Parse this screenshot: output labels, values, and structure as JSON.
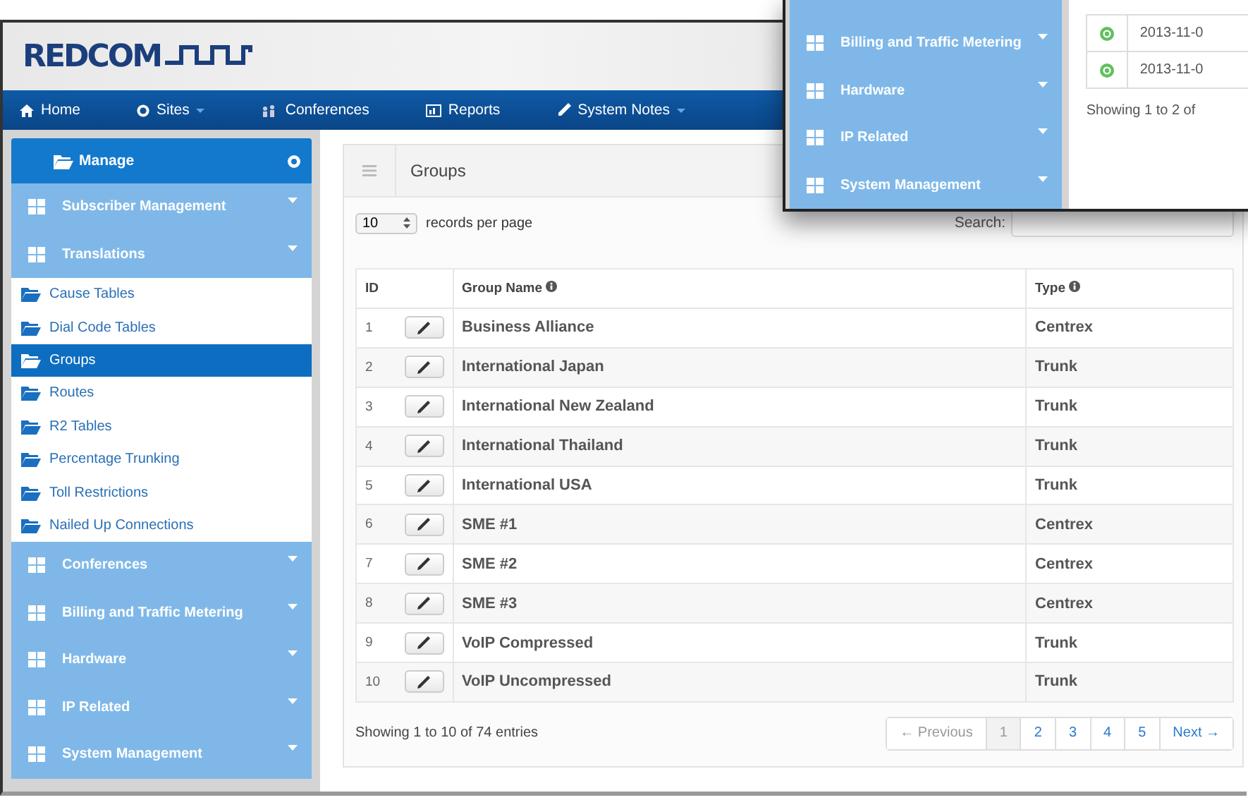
{
  "header": {
    "logo": "REDCOM"
  },
  "nav": [
    {
      "label": "Home",
      "kind": "home",
      "dropdown": false
    },
    {
      "label": "Sites",
      "kind": "sites",
      "dropdown": true
    },
    {
      "label": "Conferences",
      "kind": "conferences",
      "dropdown": false
    },
    {
      "label": "Reports",
      "kind": "reports",
      "dropdown": false
    },
    {
      "label": "System Notes",
      "kind": "notes",
      "dropdown": true
    }
  ],
  "sidebar": {
    "title": "Manage",
    "sections": [
      {
        "label": "Subscriber Management"
      },
      {
        "label": "Translations",
        "children": [
          {
            "label": "Cause Tables",
            "selected": false
          },
          {
            "label": "Dial Code Tables",
            "selected": false
          },
          {
            "label": "Groups",
            "selected": true
          },
          {
            "label": "Routes",
            "selected": false
          },
          {
            "label": "R2 Tables",
            "selected": false
          },
          {
            "label": "Percentage Trunking",
            "selected": false
          },
          {
            "label": "Toll Restrictions",
            "selected": false
          },
          {
            "label": "Nailed Up Connections",
            "selected": false
          }
        ]
      },
      {
        "label": "Conferences"
      },
      {
        "label": "Billing and Traffic Metering"
      },
      {
        "label": "Hardware"
      },
      {
        "label": "IP Related"
      },
      {
        "label": "System Management"
      }
    ]
  },
  "panel": {
    "title": "Groups",
    "page_size": "10",
    "page_size_label": "records per page",
    "search_label": "Search:",
    "columns": [
      "ID",
      "Group Name",
      "Type"
    ],
    "rows": [
      {
        "id": "1",
        "name": "Business Alliance",
        "type": "Centrex"
      },
      {
        "id": "2",
        "name": "International Japan",
        "type": "Trunk"
      },
      {
        "id": "3",
        "name": "International New Zealand",
        "type": "Trunk"
      },
      {
        "id": "4",
        "name": "International Thailand",
        "type": "Trunk"
      },
      {
        "id": "5",
        "name": "International USA",
        "type": "Trunk"
      },
      {
        "id": "6",
        "name": "SME #1",
        "type": "Centrex"
      },
      {
        "id": "7",
        "name": "SME #2",
        "type": "Centrex"
      },
      {
        "id": "8",
        "name": "SME #3",
        "type": "Centrex"
      },
      {
        "id": "9",
        "name": "VoIP Compressed",
        "type": "Trunk"
      },
      {
        "id": "10",
        "name": "VoIP Uncompressed",
        "type": "Trunk"
      }
    ],
    "info": "Showing 1 to 10 of 74 entries",
    "pagination": {
      "previous": {
        "label": "← Previous",
        "disabled": true
      },
      "pages": [
        {
          "label": "1",
          "selected": true
        },
        {
          "label": "2",
          "selected": false
        },
        {
          "label": "3",
          "selected": false
        },
        {
          "label": "4",
          "selected": false
        },
        {
          "label": "5",
          "selected": false
        }
      ],
      "next": {
        "label": "Next →",
        "disabled": false
      }
    }
  },
  "inset": {
    "sections": [
      {
        "label": "Billing and Traffic Metering"
      },
      {
        "label": "Hardware"
      },
      {
        "label": "IP Related"
      },
      {
        "label": "System Management"
      }
    ],
    "rows": [
      {
        "date": "2013-11-0"
      },
      {
        "date": "2013-11-0"
      }
    ],
    "info": "Showing 1 to 2 of"
  }
}
